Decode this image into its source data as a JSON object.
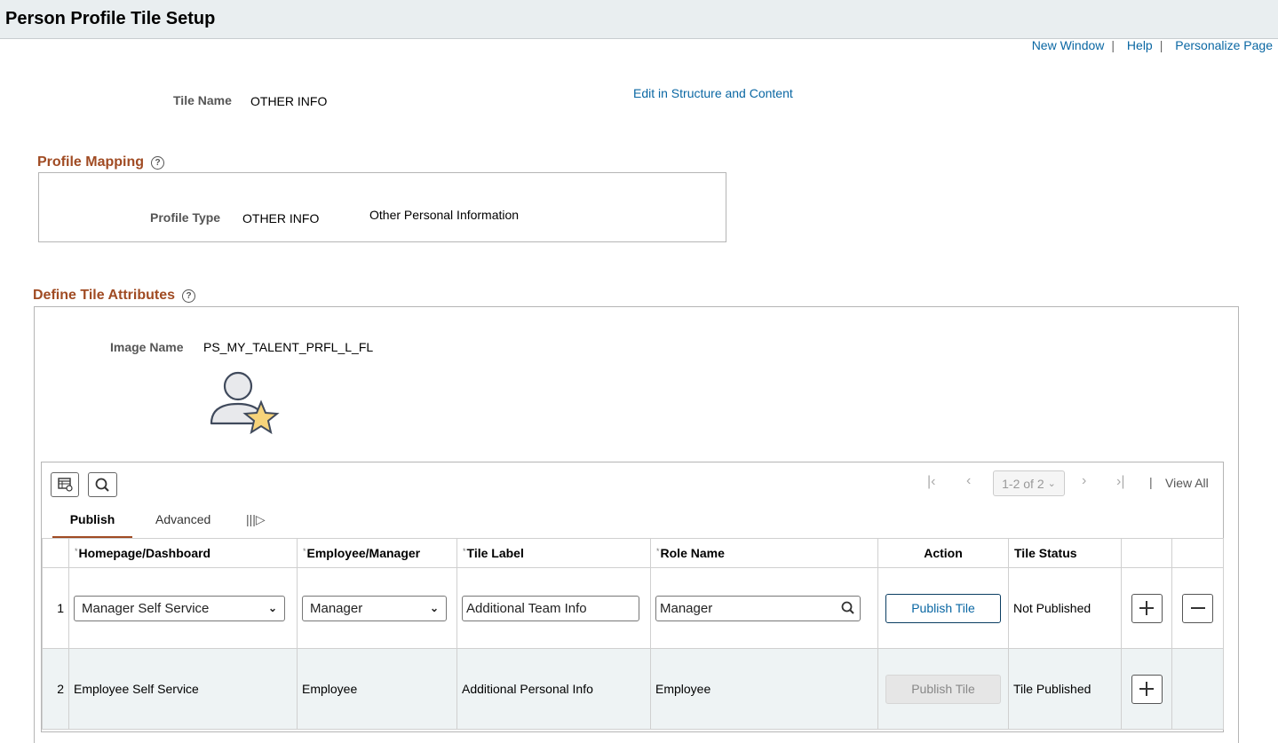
{
  "window": {
    "title": "Person Profile Tile Setup"
  },
  "toplinks": {
    "new_window": "New Window",
    "help": "Help",
    "personalize": "Personalize Page"
  },
  "tile": {
    "name_label": "Tile Name",
    "name_value": "OTHER INFO",
    "edit_link": "Edit in Structure and Content"
  },
  "profile_mapping": {
    "title": "Profile Mapping",
    "type_label": "Profile Type",
    "type_value": "OTHER INFO",
    "type_desc": "Other Personal Information"
  },
  "tile_attributes": {
    "title": "Define Tile Attributes",
    "image_label": "Image Name",
    "image_value": "PS_MY_TALENT_PRFL_L_FL"
  },
  "grid": {
    "pager": {
      "range": "1-2 of 2",
      "view_all": "View All"
    },
    "tabs": [
      {
        "label": "Publish",
        "active": true
      },
      {
        "label": "Advanced",
        "active": false
      }
    ],
    "columns": [
      "Homepage/Dashboard",
      "Employee/Manager",
      "Tile Label",
      "Role Name",
      "Action",
      "Tile Status"
    ],
    "rows": [
      {
        "num": "1",
        "homepage": "Manager Self Service",
        "emp_mgr": "Manager",
        "tile_label": "Additional Team Info",
        "role": "Manager",
        "action": "Publish Tile",
        "status": "Not Published"
      },
      {
        "num": "2",
        "homepage": "Employee Self Service",
        "emp_mgr": "Employee",
        "tile_label": "Additional Personal Info",
        "role": "Employee",
        "action": "Publish Tile",
        "status": "Tile Published"
      }
    ]
  },
  "colors": {
    "link": "#0a67a3",
    "section_title": "#a04b23",
    "tab_underline": "#a04b23",
    "row_alt": "#eef3f4"
  }
}
